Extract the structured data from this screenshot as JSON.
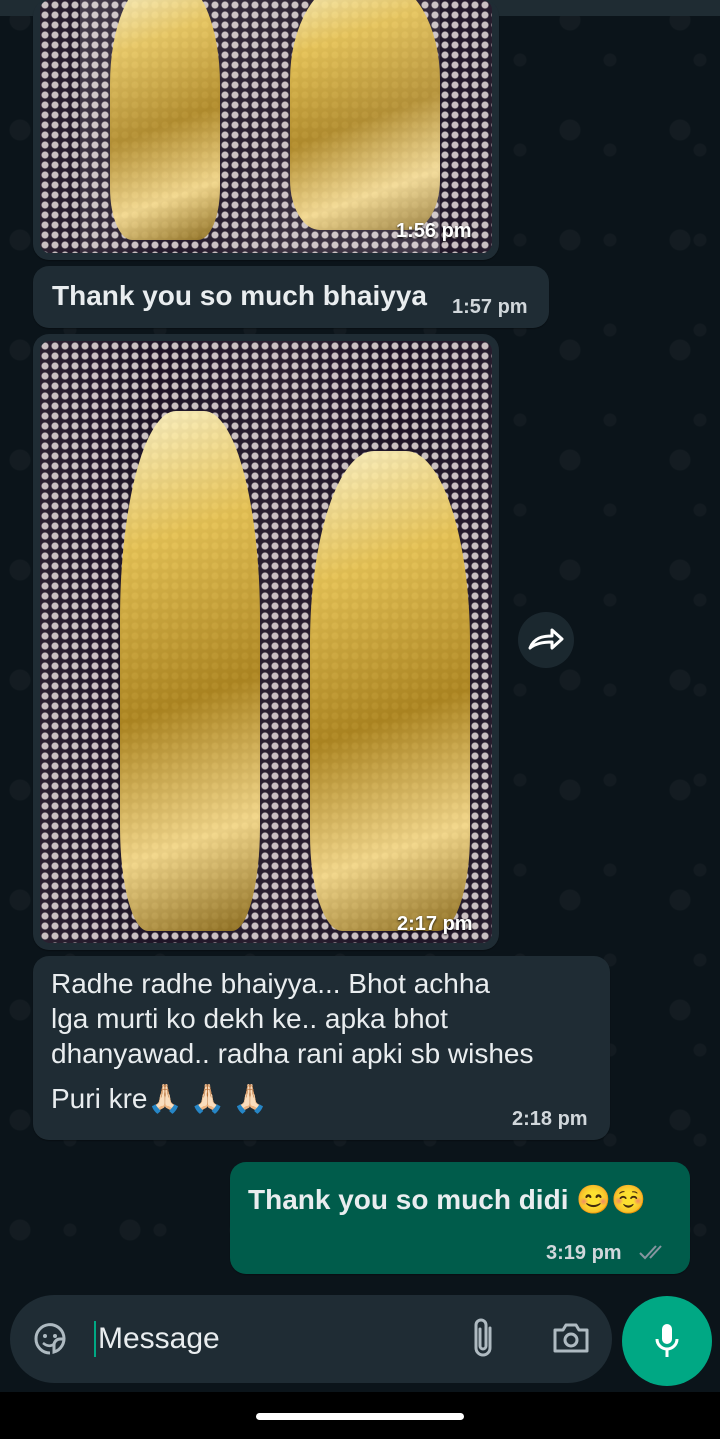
{
  "messages": [
    {
      "type": "image",
      "direction": "incoming",
      "time": "1:56 pm"
    },
    {
      "type": "text",
      "direction": "incoming",
      "text": "Thank you so much bhaiyya",
      "time": "1:57 pm"
    },
    {
      "type": "image",
      "direction": "incoming",
      "time": "2:17 pm"
    },
    {
      "type": "text",
      "direction": "incoming",
      "lines": [
        "Radhe radhe bhaiyya... Bhot achha",
        "lga murti ko dekh ke.. apka bhot",
        "dhanyawad.. radha rani apki sb wishes",
        "Puri kre🙏🏻 🙏🏻 🙏🏻"
      ],
      "time": "2:18 pm"
    },
    {
      "type": "text",
      "direction": "outgoing",
      "text": "Thank you so much didi 😊☺️",
      "time": "3:19 pm",
      "status": "read"
    }
  ],
  "composer": {
    "placeholder": "Message"
  },
  "icons": {
    "forward": "forward-icon",
    "sticker": "sticker-icon",
    "attach": "paperclip-icon",
    "camera": "camera-icon",
    "mic": "mic-icon",
    "read_receipt": "double-check-icon"
  },
  "colors": {
    "incoming_bubble": "#1f2c34",
    "outgoing_bubble": "#005c4b",
    "accent": "#00a884",
    "background": "#0b141a"
  }
}
